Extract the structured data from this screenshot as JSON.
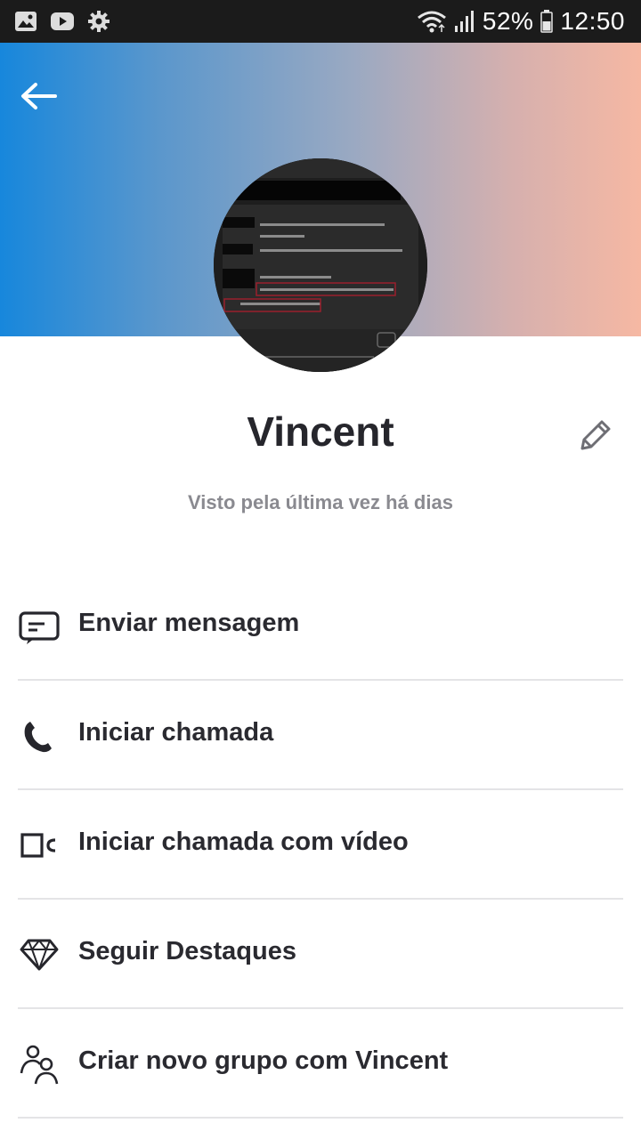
{
  "status_bar": {
    "battery": "52%",
    "time": "12:50",
    "left_icons": [
      "gallery-icon",
      "youtube-icon",
      "settings-icon"
    ],
    "right_icons": [
      "wifi-icon",
      "signal-icon",
      "battery-icon"
    ]
  },
  "header": {
    "gradient_start": "#1787dc",
    "gradient_end": "#f6b8a3",
    "back_icon": "arrow-left-icon"
  },
  "profile": {
    "name": "Vincent",
    "status": "Visto pela última vez há dias",
    "avatar_icon": "avatar-screenshot-image",
    "edit_icon": "pencil-icon"
  },
  "actions": [
    {
      "label": "Enviar mensagem",
      "icon": "message-icon"
    },
    {
      "label": "Iniciar chamada",
      "icon": "phone-icon"
    },
    {
      "label": "Iniciar chamada com vídeo",
      "icon": "video-icon"
    },
    {
      "label": "Seguir Destaques",
      "icon": "diamond-icon"
    },
    {
      "label": "Criar novo grupo com Vincent",
      "icon": "group-icon"
    }
  ],
  "colors": {
    "text_dark": "#26262c",
    "text_muted": "#8a8a90",
    "divider": "#e4e4e6"
  }
}
